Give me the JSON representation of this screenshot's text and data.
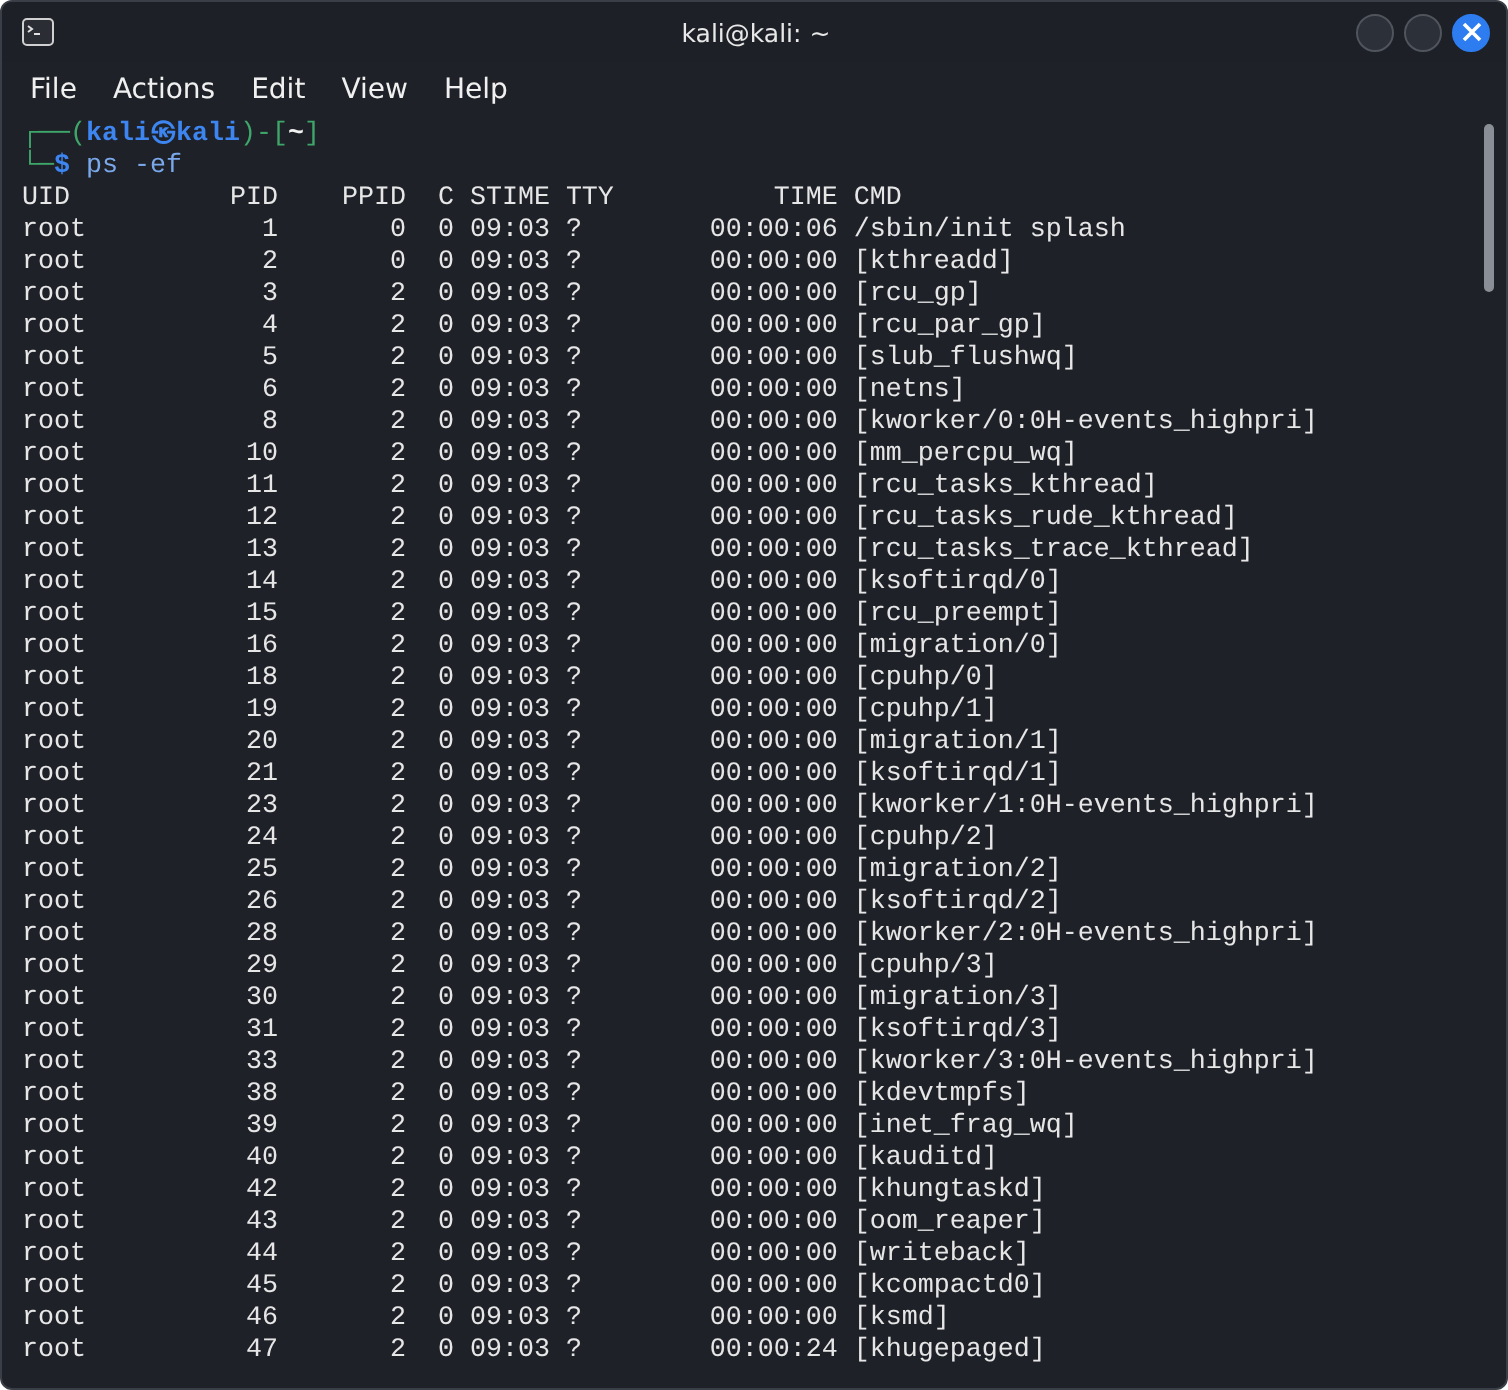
{
  "window": {
    "title": "kali@kali: ~"
  },
  "menu": [
    "File",
    "Actions",
    "Edit",
    "View",
    "Help"
  ],
  "prompt": [
    [
      {
        "text": "┌──(",
        "kind": "frame"
      },
      {
        "text": "kali㉿kali",
        "kind": "user"
      },
      {
        "text": ")-[",
        "kind": "frame"
      },
      {
        "text": "~",
        "kind": "dir"
      },
      {
        "text": "]",
        "kind": "frame"
      }
    ],
    [
      {
        "text": "└─",
        "kind": "frame"
      },
      {
        "text": "$",
        "kind": "user"
      },
      {
        "text": " ps -ef",
        "kind": "command"
      }
    ]
  ],
  "header": "UID          PID    PPID  C STIME TTY          TIME CMD",
  "output_lines": [
    "root           1       0  0 09:03 ?        00:00:06 /sbin/init splash",
    "root           2       0  0 09:03 ?        00:00:00 [kthreadd]",
    "root           3       2  0 09:03 ?        00:00:00 [rcu_gp]",
    "root           4       2  0 09:03 ?        00:00:00 [rcu_par_gp]",
    "root           5       2  0 09:03 ?        00:00:00 [slub_flushwq]",
    "root           6       2  0 09:03 ?        00:00:00 [netns]",
    "root           8       2  0 09:03 ?        00:00:00 [kworker/0:0H-events_highpri]",
    "root          10       2  0 09:03 ?        00:00:00 [mm_percpu_wq]",
    "root          11       2  0 09:03 ?        00:00:00 [rcu_tasks_kthread]",
    "root          12       2  0 09:03 ?        00:00:00 [rcu_tasks_rude_kthread]",
    "root          13       2  0 09:03 ?        00:00:00 [rcu_tasks_trace_kthread]",
    "root          14       2  0 09:03 ?        00:00:00 [ksoftirqd/0]",
    "root          15       2  0 09:03 ?        00:00:00 [rcu_preempt]",
    "root          16       2  0 09:03 ?        00:00:00 [migration/0]",
    "root          18       2  0 09:03 ?        00:00:00 [cpuhp/0]",
    "root          19       2  0 09:03 ?        00:00:00 [cpuhp/1]",
    "root          20       2  0 09:03 ?        00:00:00 [migration/1]",
    "root          21       2  0 09:03 ?        00:00:00 [ksoftirqd/1]",
    "root          23       2  0 09:03 ?        00:00:00 [kworker/1:0H-events_highpri]",
    "root          24       2  0 09:03 ?        00:00:00 [cpuhp/2]",
    "root          25       2  0 09:03 ?        00:00:00 [migration/2]",
    "root          26       2  0 09:03 ?        00:00:00 [ksoftirqd/2]",
    "root          28       2  0 09:03 ?        00:00:00 [kworker/2:0H-events_highpri]",
    "root          29       2  0 09:03 ?        00:00:00 [cpuhp/3]",
    "root          30       2  0 09:03 ?        00:00:00 [migration/3]",
    "root          31       2  0 09:03 ?        00:00:00 [ksoftirqd/3]",
    "root          33       2  0 09:03 ?        00:00:00 [kworker/3:0H-events_highpri]",
    "root          38       2  0 09:03 ?        00:00:00 [kdevtmpfs]",
    "root          39       2  0 09:03 ?        00:00:00 [inet_frag_wq]",
    "root          40       2  0 09:03 ?        00:00:00 [kauditd]",
    "root          42       2  0 09:03 ?        00:00:00 [khungtaskd]",
    "root          43       2  0 09:03 ?        00:00:00 [oom_reaper]",
    "root          44       2  0 09:03 ?        00:00:00 [writeback]",
    "root          45       2  0 09:03 ?        00:00:00 [kcompactd0]",
    "root          46       2  0 09:03 ?        00:00:00 [ksmd]",
    "root          47       2  0 09:03 ?        00:00:24 [khugepaged]"
  ]
}
